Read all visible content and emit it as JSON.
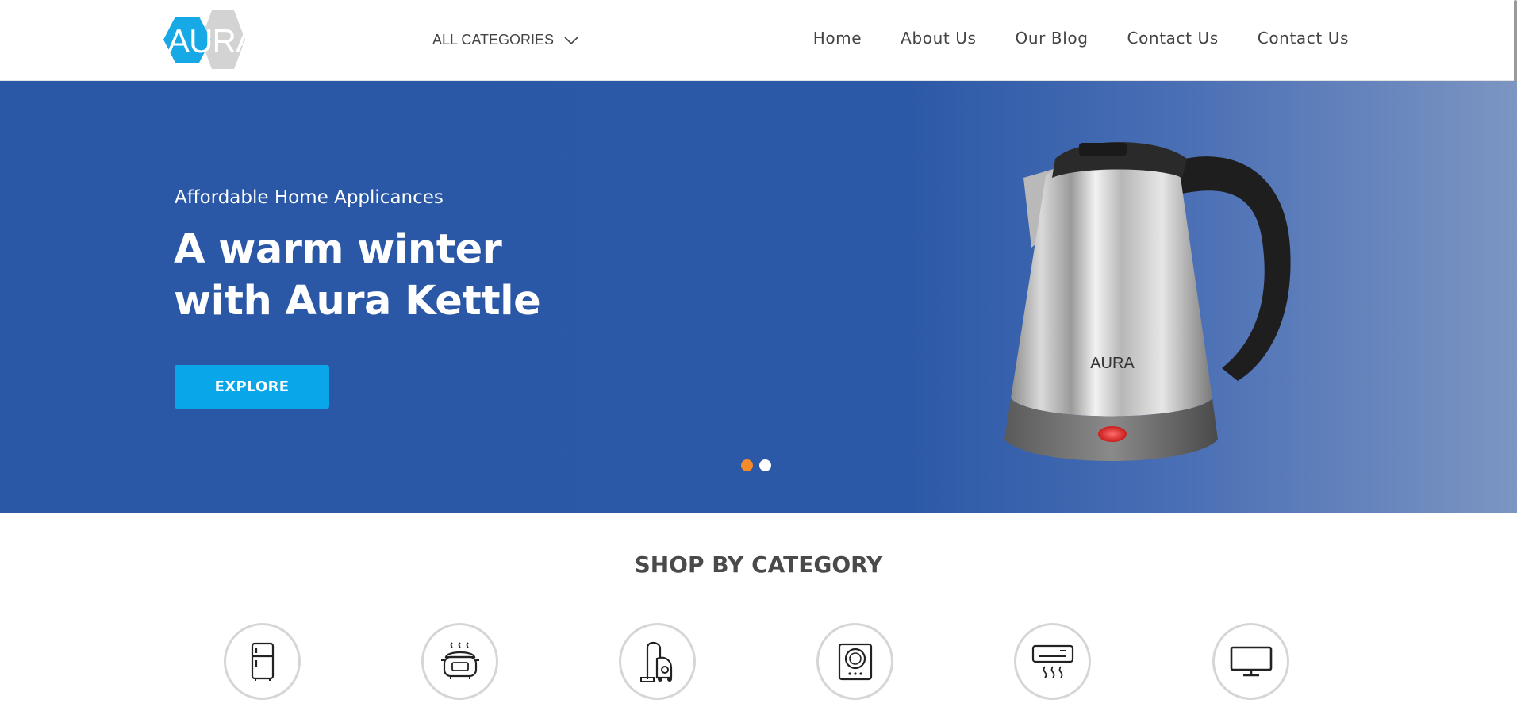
{
  "header": {
    "logo_text": "AURA",
    "categories_label": "ALL CATEGORIES",
    "nav": [
      {
        "label": "Home"
      },
      {
        "label": "About Us"
      },
      {
        "label": "Our Blog"
      },
      {
        "label": "Contact Us"
      },
      {
        "label": "Contact Us"
      }
    ]
  },
  "hero": {
    "subtitle": "Affordable Home Applicances",
    "title_line1": "A warm winter",
    "title_line2": "with Aura Kettle",
    "button_label": "EXPLORE",
    "product_brand": "AURA",
    "slides_total": 2,
    "active_slide": 1,
    "colors": {
      "background": "#2a58a6",
      "button": "#0aa6ea",
      "active_dot": "#f58a2a"
    }
  },
  "shop": {
    "title": "SHOP BY CATEGORY",
    "categories": [
      {
        "icon": "refrigerator-icon"
      },
      {
        "icon": "rice-cooker-icon"
      },
      {
        "icon": "vacuum-cleaner-icon"
      },
      {
        "icon": "induction-cooker-icon"
      },
      {
        "icon": "air-conditioner-icon"
      },
      {
        "icon": "television-icon"
      }
    ]
  }
}
